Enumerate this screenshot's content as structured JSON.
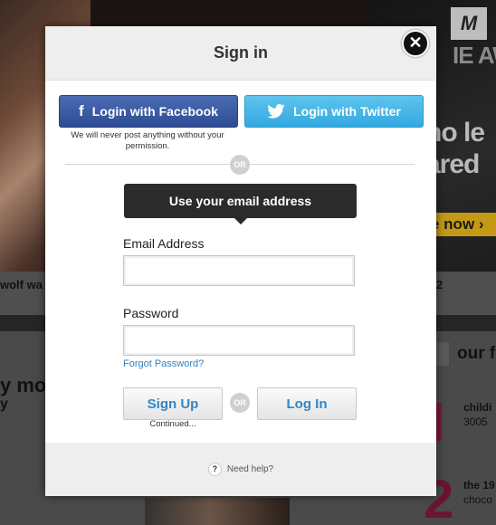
{
  "background": {
    "headline_1": "no le",
    "headline_2": "ared",
    "now_label": "e now ›",
    "strip_left": "wolf wa",
    "strip_right": "2",
    "left_line_1": "y mov",
    "left_line_2": "y",
    "right_title": "our f",
    "right_item_1_title": "childi",
    "right_item_1_sub": "3005",
    "right_item_2_title": "the 19",
    "right_item_2_sub": "choco",
    "big_number": "2",
    "mtv_logo": "M",
    "partial_award": "IE AW"
  },
  "modal": {
    "title": "Sign in",
    "close_glyph": "✕",
    "facebook_label": "Login with Facebook",
    "twitter_label": "Login with Twitter",
    "facebook_note": "We will never post anything without your permission.",
    "or_label": "OR",
    "email_tip": "Use your email address",
    "email_label": "Email Address",
    "email_value": "",
    "password_label": "Password",
    "password_value": "",
    "forgot_label": "Forgot Password?",
    "signup_label": "Sign Up",
    "login_label": "Log In",
    "continued_label": "Continued...",
    "help_label": "Need help?",
    "help_glyph": "?"
  },
  "colors": {
    "facebook": "#3b5998",
    "twitter": "#3fb2e7",
    "link": "#2f7fc1",
    "tooltip": "#2b2b2b"
  }
}
